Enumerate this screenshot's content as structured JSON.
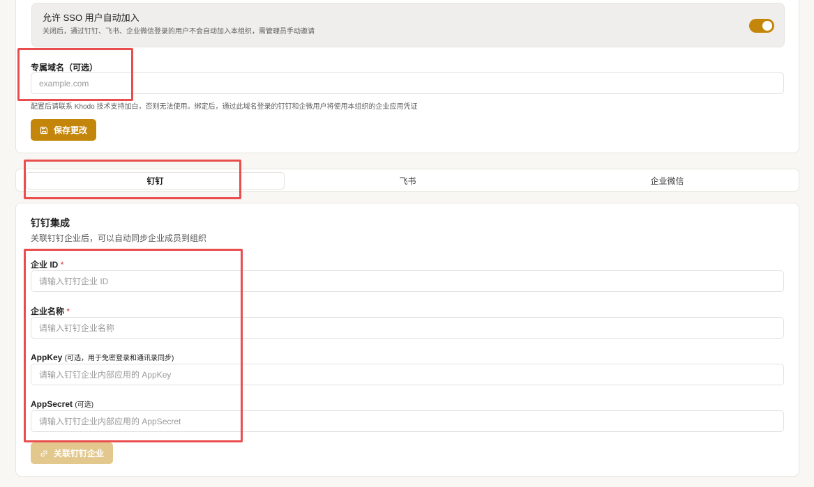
{
  "sso": {
    "title": "允许 SSO 用户自动加入",
    "description": "关闭后，通过钉钉、飞书、企业微信登录的用户不会自动加入本组织，需管理员手动邀请",
    "enabled": true
  },
  "domain": {
    "label": "专属域名（可选）",
    "placeholder": "example.com",
    "value": "",
    "help": "配置后请联系 Khodo 技术支持加白，否则无法使用。绑定后，通过此域名登录的钉钉和企微用户将使用本组织的企业应用凭证"
  },
  "save_button": {
    "label": "保存更改",
    "icon": "save-icon"
  },
  "tabs": [
    {
      "label": "钉钉",
      "active": true
    },
    {
      "label": "飞书",
      "active": false
    },
    {
      "label": "企业微信",
      "active": false
    }
  ],
  "integration": {
    "title": "钉钉集成",
    "description": "关联钉钉企业后，可以自动同步企业成员到组织",
    "fields": [
      {
        "label": "企业 ID",
        "required_mark": "*",
        "sub": "",
        "placeholder": "请输入钉钉企业 ID",
        "value": ""
      },
      {
        "label": "企业名称",
        "required_mark": "*",
        "sub": "",
        "placeholder": "请输入钉钉企业名称",
        "value": ""
      },
      {
        "label": "AppKey",
        "required_mark": "",
        "sub": "(可选，用于免密登录和通讯录同步)",
        "placeholder": "请输入钉钉企业内部应用的 AppKey",
        "value": ""
      },
      {
        "label": "AppSecret",
        "required_mark": "",
        "sub": "(可选)",
        "placeholder": "请输入钉钉企业内部应用的 AppSecret",
        "value": ""
      }
    ],
    "link_button": {
      "label": "关联钉钉企业",
      "icon": "link-icon",
      "disabled": true
    }
  },
  "colors": {
    "accent": "#c4860a",
    "accent_disabled": "#e3c88d",
    "highlight": "#ea4d4d",
    "required": "#d32f2f"
  }
}
